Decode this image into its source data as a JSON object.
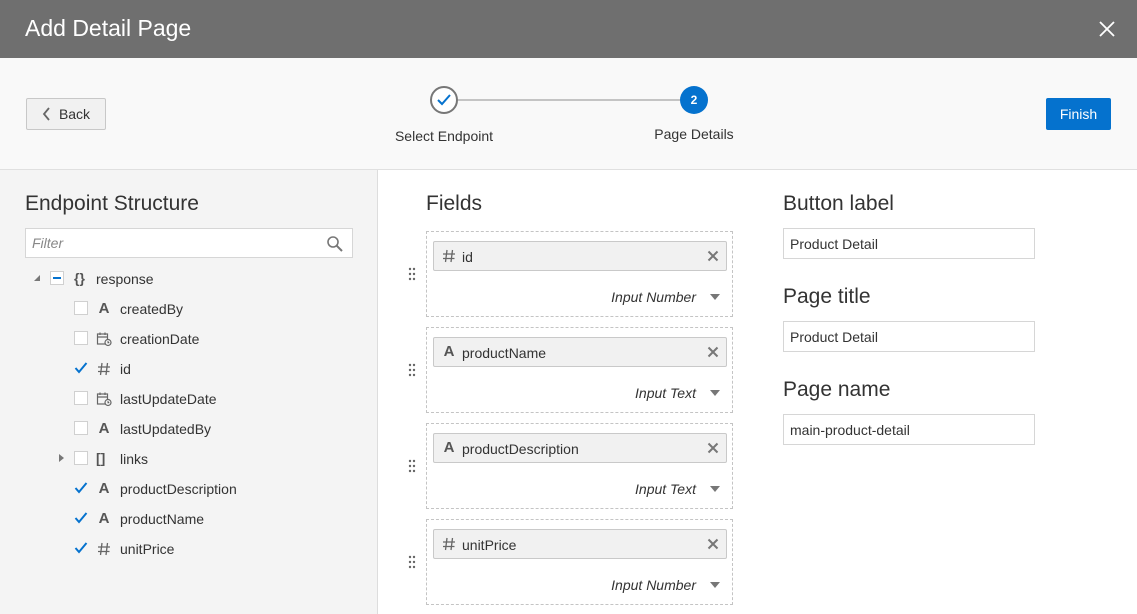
{
  "dialog": {
    "title": "Add Detail Page"
  },
  "toolbar": {
    "back_label": "Back",
    "finish_label": "Finish"
  },
  "steps": [
    {
      "label": "Select Endpoint",
      "state": "completed"
    },
    {
      "label": "Page Details",
      "number": "2",
      "state": "current"
    }
  ],
  "endpoint": {
    "heading": "Endpoint Structure",
    "filter_placeholder": "Filter",
    "root": {
      "label": "response",
      "icon": "braces-icon",
      "state": "partial"
    },
    "items": [
      {
        "label": "createdBy",
        "icon": "text-type-icon",
        "checked": false
      },
      {
        "label": "creationDate",
        "icon": "date-type-icon",
        "checked": false
      },
      {
        "label": "id",
        "icon": "number-type-icon",
        "checked": true
      },
      {
        "label": "lastUpdateDate",
        "icon": "date-type-icon",
        "checked": false
      },
      {
        "label": "lastUpdatedBy",
        "icon": "text-type-icon",
        "checked": false
      },
      {
        "label": "links",
        "icon": "array-type-icon",
        "checked": false,
        "expandable": true
      },
      {
        "label": "productDescription",
        "icon": "text-type-icon",
        "checked": true
      },
      {
        "label": "productName",
        "icon": "text-type-icon",
        "checked": true
      },
      {
        "label": "unitPrice",
        "icon": "number-type-icon",
        "checked": true
      }
    ]
  },
  "fields": {
    "heading": "Fields",
    "items": [
      {
        "name": "id",
        "icon": "number-type-icon",
        "input_type": "Input Number"
      },
      {
        "name": "productName",
        "icon": "text-type-icon",
        "input_type": "Input Text"
      },
      {
        "name": "productDescription",
        "icon": "text-type-icon",
        "input_type": "Input Text"
      },
      {
        "name": "unitPrice",
        "icon": "number-type-icon",
        "input_type": "Input Number"
      }
    ]
  },
  "settings": {
    "button_label": {
      "label": "Button label",
      "value": "Product Detail"
    },
    "page_title": {
      "label": "Page title",
      "value": "Product Detail"
    },
    "page_name": {
      "label": "Page name",
      "value": "main-product-detail"
    }
  },
  "colors": {
    "accent": "#0572ce",
    "header": "#6f6f6f",
    "panel": "#f4f4f4"
  }
}
